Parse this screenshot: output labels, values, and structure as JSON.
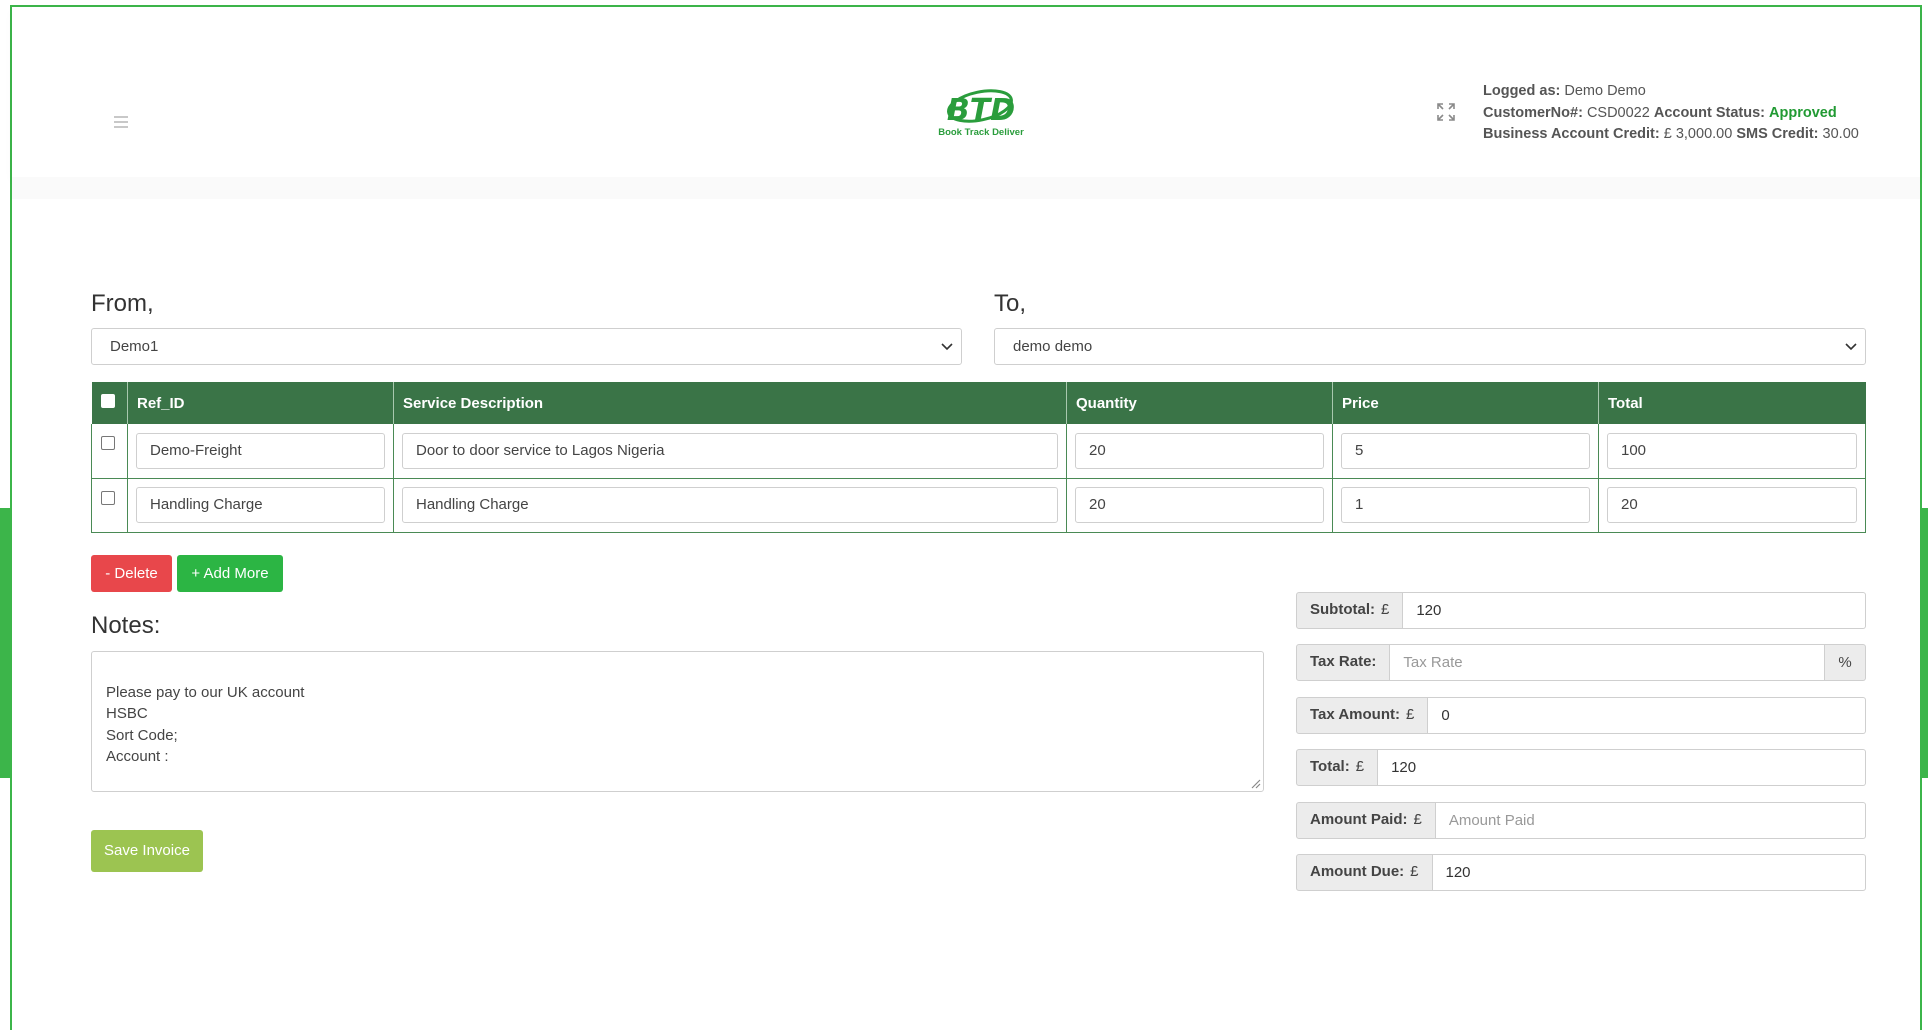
{
  "header": {
    "logo_text": "BTD",
    "logo_tagline": "Book Track Deliver",
    "logged_as_label": "Logged as:",
    "logged_as_value": "Demo Demo",
    "customer_no_label": "CustomerNo#:",
    "customer_no_value": "CSD0022",
    "account_status_label": "Account Status:",
    "account_status_value": "Approved",
    "business_credit_label": "Business Account Credit:",
    "business_credit_value": "£ 3,000.00",
    "sms_credit_label": "SMS Credit:",
    "sms_credit_value": "30.00"
  },
  "from": {
    "label": "From,",
    "selected": "Demo1"
  },
  "to": {
    "label": "To,",
    "selected": "demo demo"
  },
  "table": {
    "columns": [
      "Ref_ID",
      "Service Description",
      "Quantity",
      "Price",
      "Total"
    ],
    "rows": [
      {
        "ref_id": "Demo-Freight",
        "description": "Door to door service to Lagos Nigeria",
        "quantity": "20",
        "price": "5",
        "total": "100"
      },
      {
        "ref_id": "Handling Charge",
        "description": "Handling Charge",
        "quantity": "20",
        "price": "1",
        "total": "20"
      }
    ]
  },
  "buttons": {
    "delete": "- Delete",
    "add_more": "+ Add More",
    "save_invoice": "Save Invoice"
  },
  "notes": {
    "label": "Notes:",
    "text": "Please pay to our UK account\nHSBC\nSort Code;\nAccount :"
  },
  "summary": {
    "currency": "£",
    "subtotal_label": "Subtotal:",
    "subtotal_value": "120",
    "tax_rate_label": "Tax Rate:",
    "tax_rate_placeholder": "Tax Rate",
    "tax_rate_suffix": "%",
    "tax_amount_label": "Tax Amount:",
    "tax_amount_value": "0",
    "total_label": "Total:",
    "total_value": "120",
    "amount_paid_label": "Amount Paid:",
    "amount_paid_placeholder": "Amount Paid",
    "amount_due_label": "Amount Due:",
    "amount_due_value": "120"
  },
  "colors": {
    "brand_green": "#3cb54a",
    "table_header": "#3a7447",
    "delete_red": "#e8474b",
    "add_green": "#2cb544",
    "save_olive": "#9cc451",
    "approved_green": "#219a33"
  }
}
